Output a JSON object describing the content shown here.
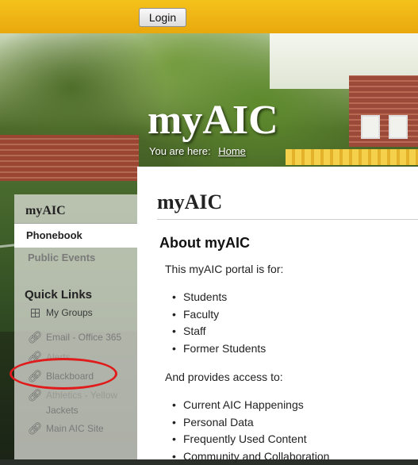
{
  "topbar": {
    "login_label": "Login"
  },
  "header": {
    "site_title": "myAIC",
    "breadcrumb_prefix": "You are here:",
    "breadcrumb_home": "Home"
  },
  "sidebar": {
    "heading": "myAIC",
    "items": [
      {
        "label": "Phonebook",
        "active": true
      },
      {
        "label": "Public Events",
        "active": false
      }
    ],
    "quick_links_heading": "Quick Links",
    "quick_links": [
      {
        "label": "My Groups",
        "icon": "grid-icon"
      },
      {
        "label": "Email - Office 365",
        "icon": "link-icon"
      },
      {
        "label": "Alerts",
        "icon": "link-icon"
      },
      {
        "label": "Blackboard",
        "icon": "link-icon"
      },
      {
        "label": "Athletics - Yellow",
        "icon": "link-icon"
      },
      {
        "label": "Jackets",
        "icon": ""
      },
      {
        "label": "Main AIC Site",
        "icon": "link-icon"
      }
    ]
  },
  "main": {
    "page_title": "myAIC",
    "section_title": "About myAIC",
    "intro": "This myAIC portal is for:",
    "audience": [
      "Students",
      "Faculty",
      "Staff",
      "Former Students"
    ],
    "access_intro": "And provides access to:",
    "access": [
      "Current AIC Happenings",
      "Personal Data",
      "Frequently Used Content",
      "Community and Collaboration"
    ]
  },
  "annotation": {
    "color": "#e01b1b",
    "target": "Blackboard"
  },
  "colors": {
    "topbar": "#f5c21b",
    "panel": "#ffffff"
  }
}
